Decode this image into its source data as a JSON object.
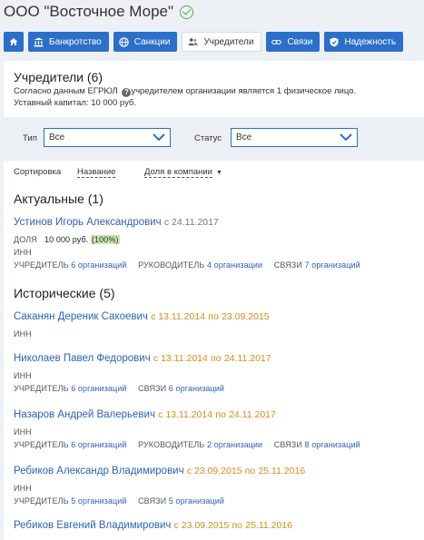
{
  "company": {
    "name": "ООО \"Восточное Море\""
  },
  "tabs": [
    {
      "label": ""
    },
    {
      "label": "Банкротство"
    },
    {
      "label": "Санкции"
    },
    {
      "label": "Учредители"
    },
    {
      "label": "Связи"
    },
    {
      "label": "Надежность"
    }
  ],
  "founders": {
    "title": "Учредители (6)",
    "desc_part1": "Согласно данным ЕГРЮЛ",
    "desc_part2": "учредителем организации является 1 физическое лицо.",
    "capital": "Уставный капитал: 10 000 руб."
  },
  "filters": {
    "type_label": "Тип",
    "type_value": "Все",
    "status_label": "Статус",
    "status_value": "Все"
  },
  "sort": {
    "label": "Сортировка",
    "option_name": "Название",
    "option_share": "Доля в компании"
  },
  "actual": {
    "title": "Актуальные (1)",
    "persons": [
      {
        "name": "Устинов Игорь Александрович",
        "date": "с 24.11.2017",
        "share_label": "ДОЛЯ",
        "share_value": "10 000 руб.",
        "share_pct": "(100%)",
        "inn_label": "ИНН",
        "roles": [
          {
            "label": "УЧРЕДИТЕЛЬ",
            "value": "6 организаций"
          },
          {
            "label": "РУКОВОДИТЕЛЬ",
            "value": "4 организации"
          },
          {
            "label": "СВЯЗИ",
            "value": "7 организаций"
          }
        ]
      }
    ]
  },
  "historic": {
    "title": "Исторические (5)",
    "persons": [
      {
        "name": "Саканян Дереник Сакоевич",
        "date_from": "с 13.11.2014",
        "sep": "по",
        "date_to": "23.09.2015",
        "inn_label": "ИНН",
        "roles": []
      },
      {
        "name": "Николаев Павел Федорович",
        "date_from": "с 13.11.2014",
        "sep": "по",
        "date_to": "24.11.2017",
        "inn_label": "ИНН",
        "roles": [
          {
            "label": "УЧРЕДИТЕЛЬ",
            "value": "6 организаций"
          },
          {
            "label": "СВЯЗИ",
            "value": "6 организаций"
          }
        ]
      },
      {
        "name": "Назаров Андрей Валерьевич",
        "date_from": "с 13.11.2014",
        "sep": "по",
        "date_to": "24.11.2017",
        "inn_label": "ИНН",
        "roles": [
          {
            "label": "УЧРЕДИТЕЛЬ",
            "value": "6 организаций"
          },
          {
            "label": "РУКОВОДИТЕЛЬ",
            "value": "2 организации"
          },
          {
            "label": "СВЯЗИ",
            "value": "8 организаций"
          }
        ]
      },
      {
        "name": "Ребиков Александр Владимирович",
        "date_from": "с 23.09.2015",
        "sep": "по",
        "date_to": "25.11.2016",
        "inn_label": "ИНН",
        "roles": [
          {
            "label": "УЧРЕДИТЕЛЬ",
            "value": "5 организаций"
          },
          {
            "label": "СВЯЗИ",
            "value": "5 организаций"
          }
        ]
      },
      {
        "name": "Ребиков Евгений Владимирович",
        "date_from": "с 23.09.2015",
        "sep": "по",
        "date_to": "25.11.2016",
        "inn_label": "",
        "roles": []
      }
    ]
  },
  "colors": {
    "accent": "#2c6fc9",
    "link": "#2c63b3",
    "date_hist": "#d98a1c",
    "pct_bg": "#c7e7b4"
  },
  "icons": [
    "home-icon",
    "bank-icon",
    "globe-icon",
    "people-icon",
    "link-icon",
    "shield-icon",
    "check-circle-icon",
    "help-icon",
    "chevron-down-icon"
  ]
}
